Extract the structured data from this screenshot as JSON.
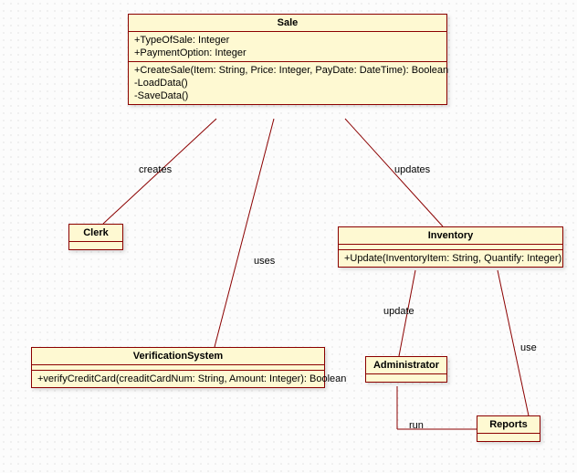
{
  "classes": {
    "sale": {
      "name": "Sale",
      "attrs": [
        "+TypeOfSale: Integer",
        "+PaymentOption: Integer"
      ],
      "ops": [
        "+CreateSale(Item: String, Price: Integer, PayDate: DateTime): Boolean",
        "-LoadData()",
        "-SaveData()"
      ]
    },
    "clerk": {
      "name": "Clerk"
    },
    "verification": {
      "name": "VerificationSystem",
      "ops": [
        "+verifyCreditCard(creaditCardNum: String, Amount: Integer): Boolean"
      ]
    },
    "inventory": {
      "name": "Inventory",
      "ops": [
        "+Update(InventoryItem: String, Quantify: Integer)"
      ]
    },
    "admin": {
      "name": "Administrator"
    },
    "reports": {
      "name": "Reports"
    }
  },
  "edges": {
    "creates": "creates",
    "uses": "uses",
    "updates": "updates",
    "update": "update",
    "use": "use",
    "run": "run"
  },
  "chart_data": {
    "type": "uml-class-diagram",
    "nodes": [
      {
        "id": "Sale",
        "attributes": [
          "+TypeOfSale: Integer",
          "+PaymentOption: Integer"
        ],
        "operations": [
          "+CreateSale(Item: String, Price: Integer, PayDate: DateTime): Boolean",
          "-LoadData()",
          "-SaveData()"
        ]
      },
      {
        "id": "Clerk"
      },
      {
        "id": "VerificationSystem",
        "operations": [
          "+verifyCreditCard(creaditCardNum: String, Amount: Integer): Boolean"
        ]
      },
      {
        "id": "Inventory",
        "operations": [
          "+Update(InventoryItem: String, Quantify: Integer)"
        ]
      },
      {
        "id": "Administrator"
      },
      {
        "id": "Reports"
      }
    ],
    "relations": [
      {
        "from": "Clerk",
        "to": "Sale",
        "label": "creates"
      },
      {
        "from": "VerificationSystem",
        "to": "Sale",
        "label": "uses"
      },
      {
        "from": "Sale",
        "to": "Inventory",
        "label": "updates"
      },
      {
        "from": "Administrator",
        "to": "Inventory",
        "label": "update"
      },
      {
        "from": "Reports",
        "to": "Inventory",
        "label": "use"
      },
      {
        "from": "Administrator",
        "to": "Reports",
        "label": "run"
      }
    ]
  }
}
